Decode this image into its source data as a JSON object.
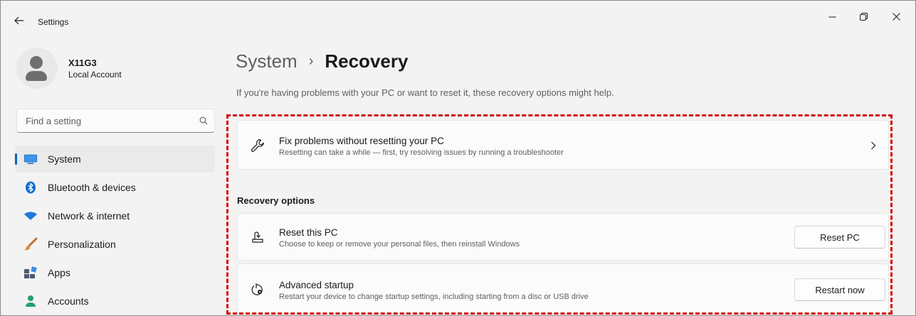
{
  "window": {
    "title": "Settings",
    "controls": [
      "minimize",
      "maximize",
      "close"
    ]
  },
  "profile": {
    "name": "X11G3",
    "account_type": "Local Account"
  },
  "search": {
    "placeholder": "Find a setting"
  },
  "sidebar": {
    "items": [
      {
        "label": "System",
        "icon": "monitor-icon",
        "active": true
      },
      {
        "label": "Bluetooth & devices",
        "icon": "bluetooth-icon",
        "active": false
      },
      {
        "label": "Network & internet",
        "icon": "wifi-icon",
        "active": false
      },
      {
        "label": "Personalization",
        "icon": "brush-icon",
        "active": false
      },
      {
        "label": "Apps",
        "icon": "apps-icon",
        "active": false
      },
      {
        "label": "Accounts",
        "icon": "person-icon",
        "active": false
      }
    ]
  },
  "main": {
    "breadcrumb": {
      "parent": "System",
      "separator": "›",
      "current": "Recovery"
    },
    "intro": "If you're having problems with your PC or want to reset it, these recovery options might help.",
    "fix_card": {
      "title": "Fix problems without resetting your PC",
      "description": "Resetting can take a while — first, try resolving issues by running a troubleshooter",
      "icon": "wrench-icon"
    },
    "section_heading": "Recovery options",
    "reset_card": {
      "title": "Reset this PC",
      "description": "Choose to keep or remove your personal files, then reinstall Windows",
      "button": "Reset PC",
      "icon": "reset-pc-icon"
    },
    "advanced_card": {
      "title": "Advanced startup",
      "description": "Restart your device to change startup settings, including starting from a disc or USB drive",
      "button": "Restart now",
      "icon": "advanced-startup-icon"
    }
  },
  "colors": {
    "accent": "#0067c0",
    "highlight_border": "#d40000",
    "background": "#f3f3f3",
    "card": "#fbfbfb"
  }
}
